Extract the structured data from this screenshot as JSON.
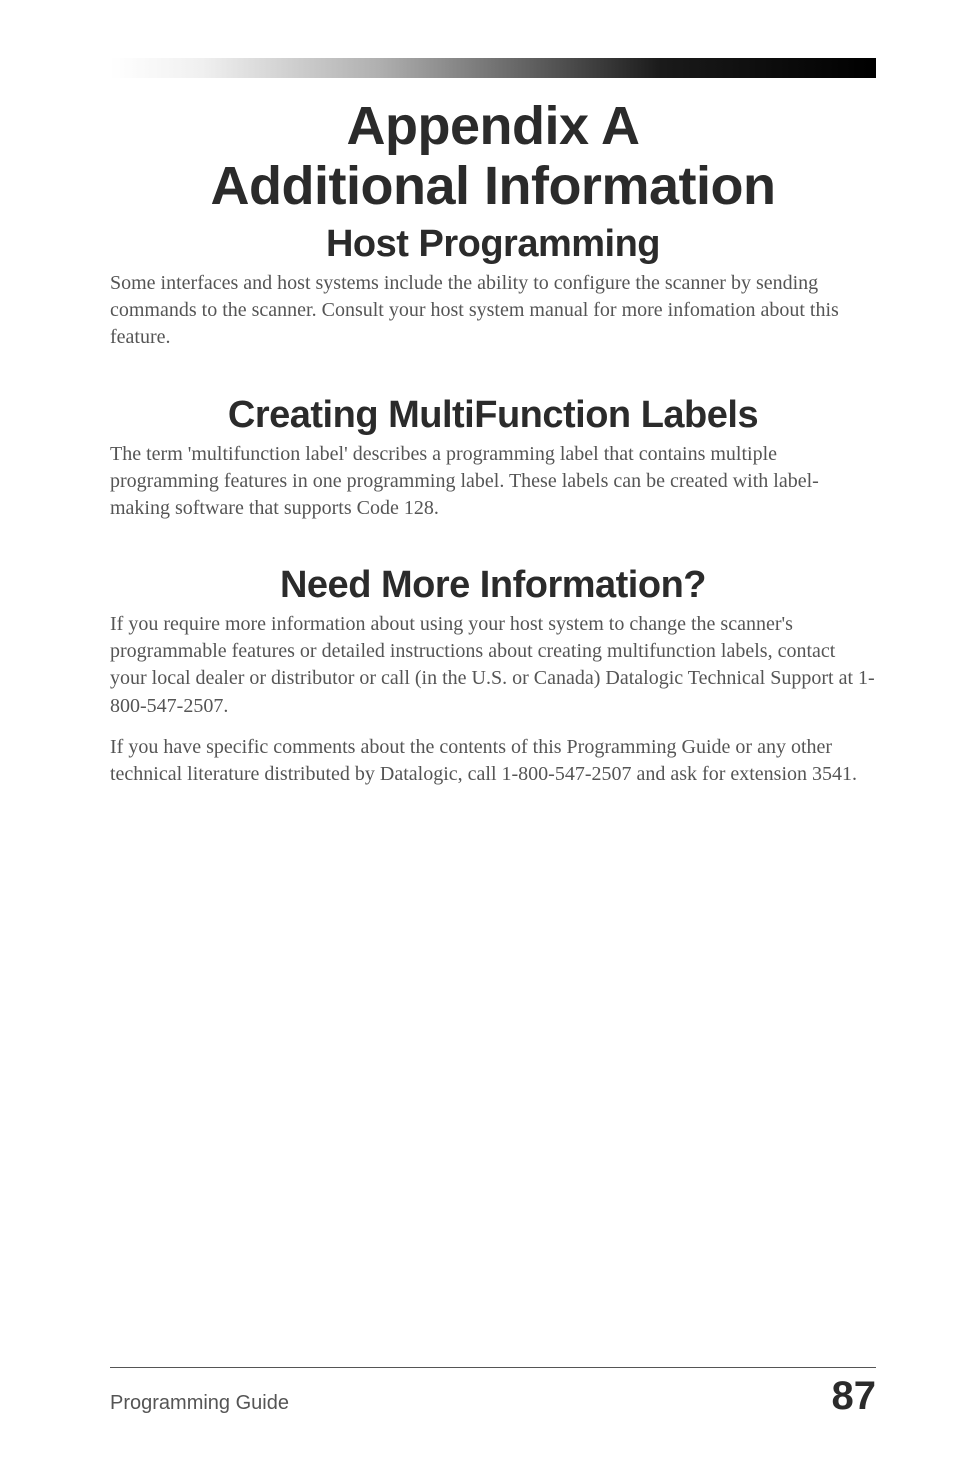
{
  "title": {
    "line1": "Appendix A",
    "line2": "Additional Information"
  },
  "sections": {
    "hostProgramming": {
      "heading": "Host Programming",
      "paragraphs": [
        "Some interfaces and host systems include the ability to configure the scanner by sending commands to the scanner.  Consult your host system manual for more infomation about this feature."
      ]
    },
    "multiFunction": {
      "heading": "Creating MultiFunction Labels",
      "paragraphs": [
        "The term 'multifunction label' describes a programming label that contains multiple programming features in one programming label.  These labels can be created with label-making software that supports Code 128."
      ]
    },
    "needMore": {
      "heading": "Need More Information?",
      "paragraphs": [
        "If you require more information about using your host system to change the scanner's programmable features or detailed instructions about creating multifunction labels, contact your local dealer or distributor or call (in the U.S. or Canada) Datalogic Technical Support at 1-800-547-2507.",
        "If you have specific comments about the contents of this Programming Guide or any other technical literature distributed by Datalogic, call 1-800-547-2507 and ask for extension 3541."
      ]
    }
  },
  "footer": {
    "left": "Programming Guide",
    "pageNumber": "87"
  }
}
